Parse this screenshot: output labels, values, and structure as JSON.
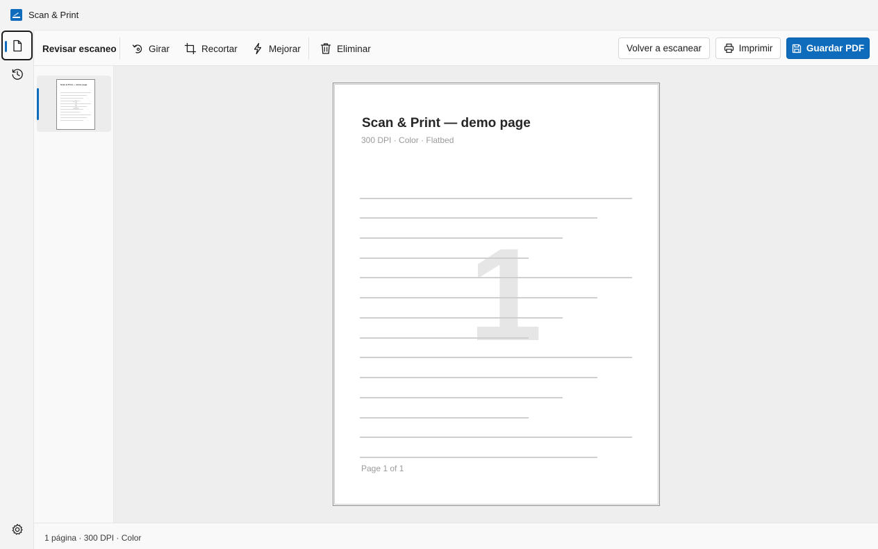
{
  "app": {
    "title": "Scan & Print"
  },
  "toolbar": {
    "section_title": "Revisar escaneo",
    "rotate_label": "Girar",
    "crop_label": "Recortar",
    "enhance_label": "Mejorar",
    "delete_label": "Eliminar",
    "rescan_label": "Volver a escanear",
    "print_label": "Imprimir",
    "save_pdf_label": "Guardar PDF"
  },
  "thumbnail": {
    "title": "Scan & Print — demo page",
    "number": "1"
  },
  "page": {
    "title": "Scan & Print — demo page",
    "subtitle": "300 DPI · Color · Flatbed",
    "watermark_number": "1",
    "footer": "Page 1 of 1"
  },
  "status": {
    "text": "1 página · 300 DPI · Color"
  },
  "colors": {
    "accent": "#0f6cbd",
    "canvas": "#eeeeee"
  },
  "icons": {
    "app": "scanner-icon",
    "rail_review": "document-icon",
    "rail_history": "history-icon",
    "rail_settings": "gear-icon"
  }
}
